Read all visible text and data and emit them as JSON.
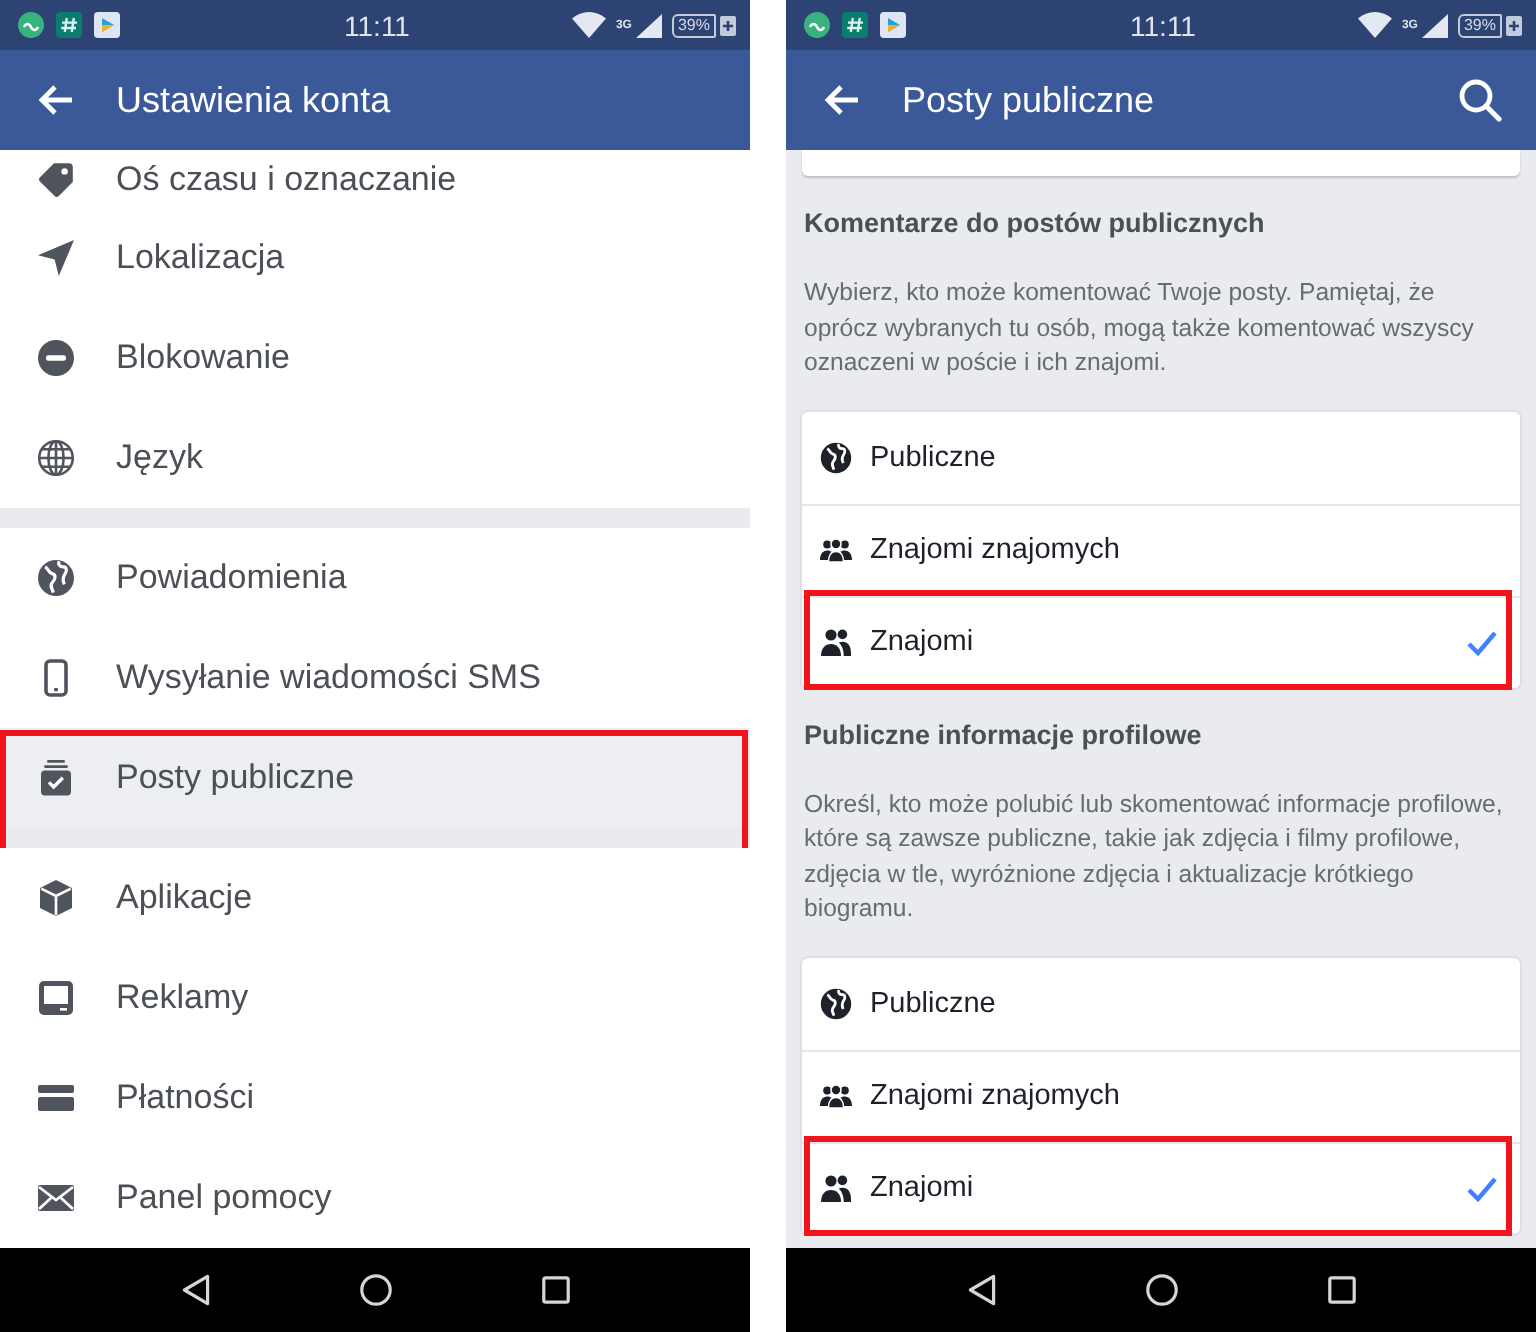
{
  "screens": [
    {
      "kind": "settings_list",
      "status_bar": {
        "time": "11:11",
        "network": "3G",
        "battery": "39%"
      },
      "app_bar": {
        "title": "Ustawienia konta"
      },
      "sections": [
        {
          "items": [
            {
              "label": "Oś czasu i oznaczanie",
              "selected": false,
              "highlighted": false
            },
            {
              "label": "Lokalizacja",
              "selected": false,
              "highlighted": false
            },
            {
              "label": "Blokowanie",
              "selected": false,
              "highlighted": false
            },
            {
              "label": "Język",
              "selected": false,
              "highlighted": false
            }
          ]
        },
        {
          "items": [
            {
              "label": "Powiadomienia",
              "selected": false,
              "highlighted": false
            },
            {
              "label": "Wysyłanie wiadomości SMS",
              "selected": false,
              "highlighted": false
            },
            {
              "label": "Posty publiczne",
              "selected": true,
              "highlighted": true
            }
          ]
        },
        {
          "items": [
            {
              "label": "Aplikacje",
              "selected": false,
              "highlighted": false
            },
            {
              "label": "Reklamy",
              "selected": false,
              "highlighted": false
            },
            {
              "label": "Płatności",
              "selected": false,
              "highlighted": false
            },
            {
              "label": "Panel pomocy",
              "selected": false,
              "highlighted": false
            }
          ]
        }
      ]
    },
    {
      "kind": "audience_settings",
      "status_bar": {
        "time": "11:11",
        "network": "3G",
        "battery": "39%"
      },
      "app_bar": {
        "title": "Posty publiczne",
        "search_button": true
      },
      "groups": [
        {
          "heading": "Komentarze do postów publicznych",
          "description": "Wybierz, kto może komentować Twoje posty. Pamiętaj, że\noprócz wybranych tu osób, mogą także komentować wszyscy oznaczeni w poście i ich znajomi.",
          "options": [
            {
              "label": "Publiczne",
              "selected": false,
              "highlighted": false
            },
            {
              "label": "Znajomi znajomych",
              "selected": false,
              "highlighted": false
            },
            {
              "label": "Znajomi",
              "selected": true,
              "highlighted": true
            }
          ]
        },
        {
          "heading": "Publiczne informacje profilowe",
          "description": "Określ, kto może polubić lub skomentować informacje profilowe, które są zawsze publiczne, takie jak zdjęcia i filmy profilowe, zdjęcia w tle, wyróżnione zdjęcia i aktualizacje krótkiego biogramu.",
          "options": [
            {
              "label": "Publiczne",
              "selected": false,
              "highlighted": false
            },
            {
              "label": "Znajomi znajomych",
              "selected": false,
              "highlighted": false
            },
            {
              "label": "Znajomi",
              "selected": true,
              "highlighted": true
            }
          ]
        }
      ]
    }
  ]
}
